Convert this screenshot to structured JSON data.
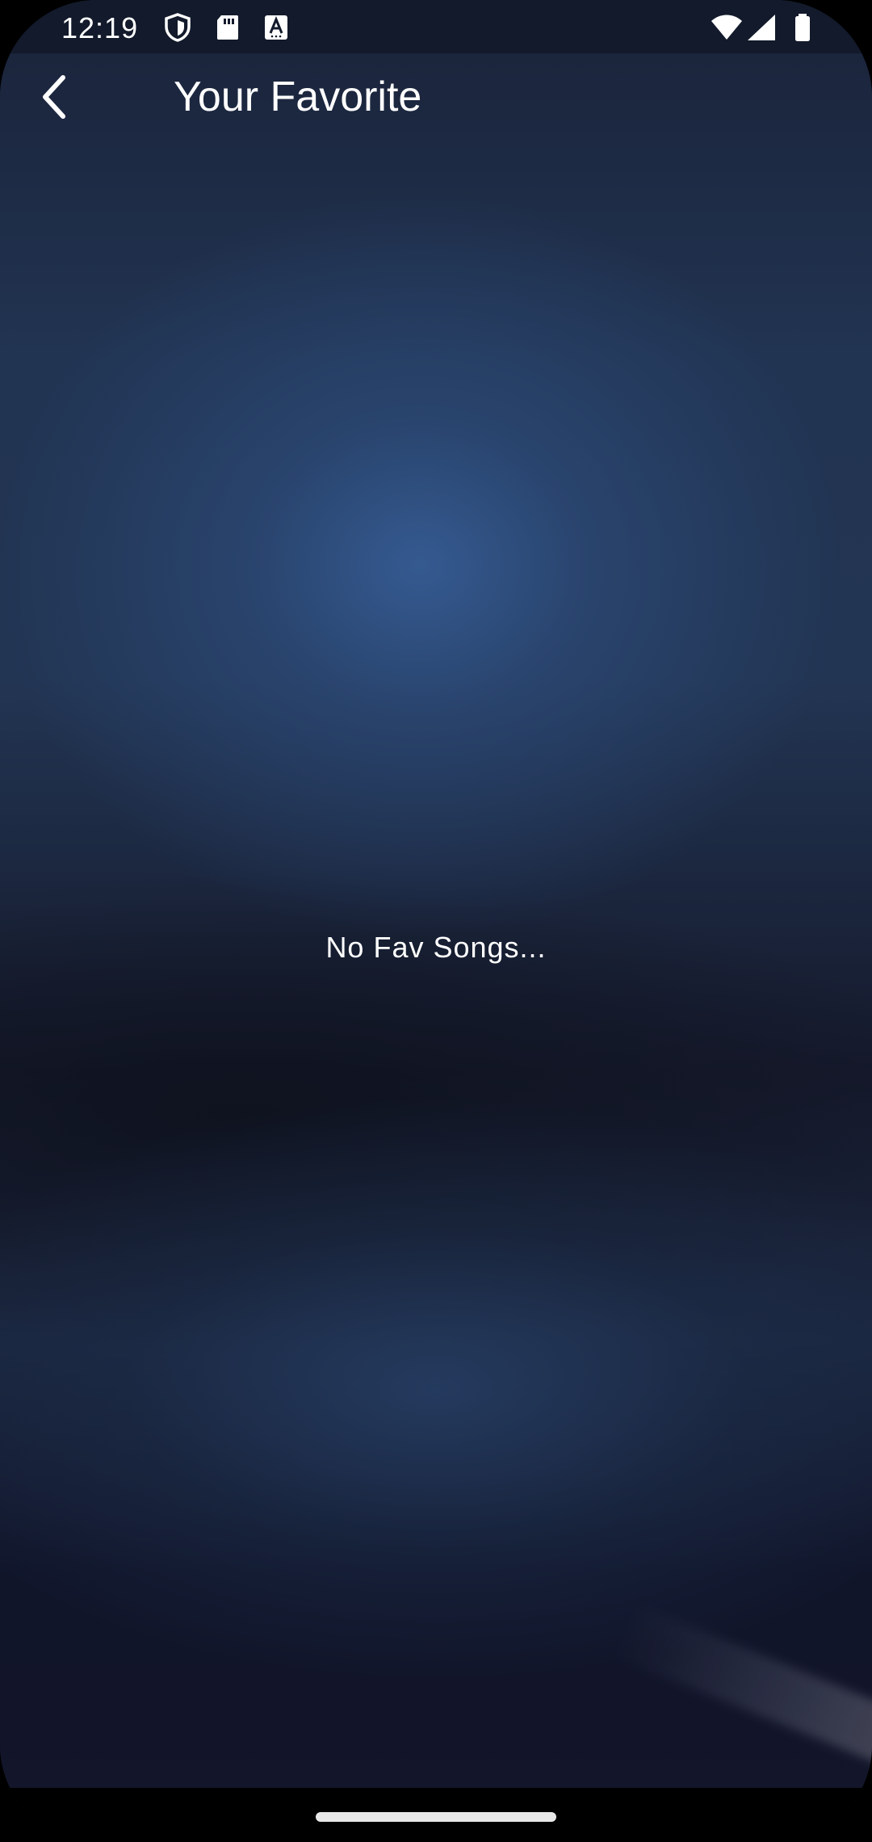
{
  "status_bar": {
    "time": "12:19",
    "left_icons": [
      "shield-icon",
      "sd-card-icon",
      "translate-a-icon"
    ],
    "right_icons": [
      "wifi-icon",
      "cell-signal-icon",
      "battery-icon"
    ]
  },
  "app_bar": {
    "back_icon": "chevron-left-icon",
    "title": "Your Favorite"
  },
  "content": {
    "empty_message": "No Fav Songs..."
  },
  "colors": {
    "text": "#ffffff",
    "status_bar_bg": "#121a2b",
    "nav_bar_bg": "#000000",
    "accent_glow": "#365c94"
  }
}
